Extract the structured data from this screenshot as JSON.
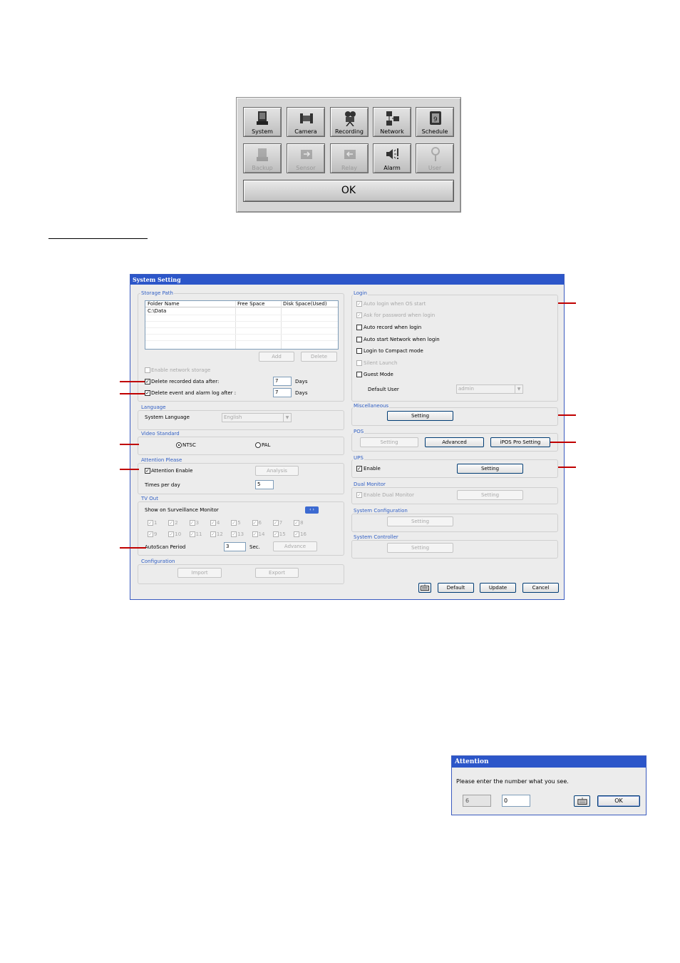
{
  "menu": {
    "buttons": [
      {
        "label": "System",
        "icon": "monitor-icon",
        "enabled": true
      },
      {
        "label": "Camera",
        "icon": "camera-icon",
        "enabled": true
      },
      {
        "label": "Recording",
        "icon": "movie-camera-icon",
        "enabled": true
      },
      {
        "label": "Network",
        "icon": "network-icon",
        "enabled": true
      },
      {
        "label": "Schedule",
        "icon": "schedule-icon",
        "enabled": true
      },
      {
        "label": "Backup",
        "icon": "backup-icon",
        "enabled": false
      },
      {
        "label": "Sensor",
        "icon": "sensor-icon",
        "enabled": false
      },
      {
        "label": "Relay",
        "icon": "relay-icon",
        "enabled": false
      },
      {
        "label": "Alarm",
        "icon": "speaker-alarm-icon",
        "enabled": true
      },
      {
        "label": "User",
        "icon": "user-icon",
        "enabled": false
      }
    ],
    "ok_label": "OK"
  },
  "system_setting": {
    "title": "System Setting",
    "storage": {
      "group": "Storage Path",
      "columns": [
        "Folder Name",
        "Free Space",
        "Disk Space(Used)"
      ],
      "rows": [
        [
          "C:\\Data",
          "",
          ""
        ]
      ],
      "add_label": "Add",
      "delete_label": "Delete",
      "enable_network_storage": "Enable network storage",
      "delete_recorded": "Delete recorded data after:",
      "delete_recorded_value": "7",
      "delete_log": "Delete event and alarm log after :",
      "delete_log_value": "7",
      "days_label": "Days"
    },
    "language": {
      "group": "Language",
      "label": "System Language",
      "value": "English"
    },
    "video": {
      "group": "Video Standard",
      "ntsc": "NTSC",
      "pal": "PAL"
    },
    "attention": {
      "group": "Attention Please",
      "enable_label": "Attention Enable",
      "analysis_label": "Analysis",
      "times_label": "Times per day",
      "times_value": "5"
    },
    "tvout": {
      "group": "TV Out",
      "show_label": "Show on Surveillance Monitor",
      "channels": [
        "1",
        "2",
        "3",
        "4",
        "5",
        "6",
        "7",
        "8",
        "9",
        "10",
        "11",
        "12",
        "13",
        "14",
        "15",
        "16"
      ],
      "autoscan_label": "AutoScan Period",
      "autoscan_value": "3",
      "sec_label": "Sec.",
      "advance_label": "Advance"
    },
    "configuration": {
      "group": "Configuration",
      "import_label": "Import",
      "export_label": "Export"
    },
    "login": {
      "group": "Login",
      "auto_login": "Auto login when OS start",
      "ask_password": "Ask for password when login",
      "auto_record": "Auto record when login",
      "auto_network": "Auto start Network when login",
      "compact_mode": "Login to Compact mode",
      "silent_launch": "Silent Launch",
      "guest_mode": "Guest Mode",
      "default_user_label": "Default User",
      "default_user_value": "admin"
    },
    "misc": {
      "group": "Miscellaneous",
      "setting_label": "Setting"
    },
    "pos": {
      "group": "POS",
      "setting_label": "Setting",
      "advanced_label": "Advanced",
      "ipos_label": "iPOS Pro Setting"
    },
    "ups": {
      "group": "UPS",
      "enable_label": "Enable",
      "setting_label": "Setting"
    },
    "dual_monitor": {
      "group": "Dual Monitor",
      "enable_label": "Enable Dual Monitor",
      "setting_label": "Setting"
    },
    "sys_config": {
      "group": "System Configuration",
      "setting_label": "Setting"
    },
    "sys_controller": {
      "group": "System Controller",
      "setting_label": "Setting"
    },
    "footer": {
      "default_label": "Default",
      "update_label": "Update",
      "cancel_label": "Cancel"
    }
  },
  "attention_dialog": {
    "title": "Attention",
    "message": "Please enter the number what you see.",
    "code": "6",
    "input_value": "0",
    "ok_label": "OK"
  },
  "colors": {
    "accent": "#2c56c9",
    "group_title": "#2f5ec4",
    "callout": "#c00000"
  }
}
